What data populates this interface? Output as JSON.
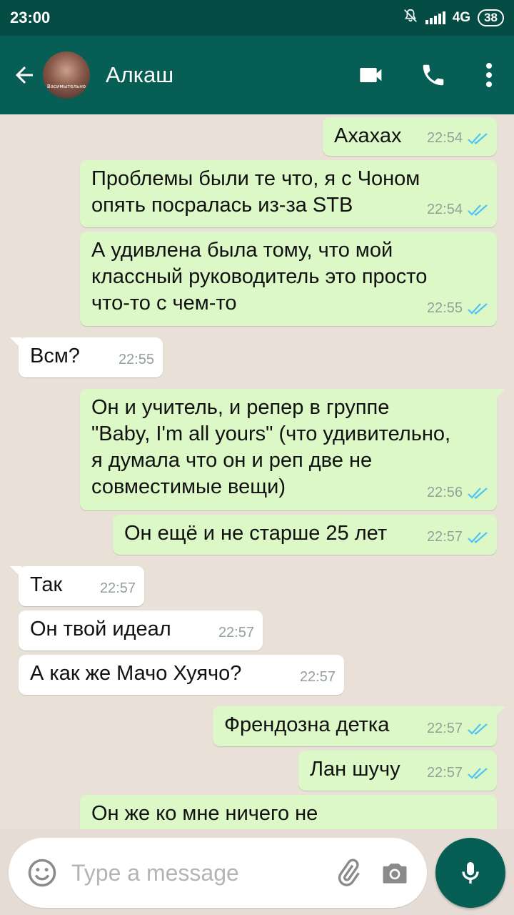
{
  "status": {
    "time": "23:00",
    "network": "4G",
    "battery": "38"
  },
  "header": {
    "contact_name": "Алкаш",
    "avatar_caption": "Васимытельно"
  },
  "messages": [
    {
      "dir": "out",
      "text": "Ахахах",
      "time": "22:54"
    },
    {
      "dir": "out",
      "text": "Проблемы были те что, я с Чоном опять посралась из-за STB",
      "time": "22:54"
    },
    {
      "dir": "out",
      "text": "А удивлена была тому, что мой классный руководитель это просто что-то с чем-то",
      "time": "22:55"
    },
    {
      "dir": "in",
      "text": "Всм?",
      "time": "22:55"
    },
    {
      "dir": "out",
      "text": "Он и учитель, и репер в группе \"Baby, I'm all yours\" (что удивительно, я думала что он и реп две не совместимые вещи)",
      "time": "22:56"
    },
    {
      "dir": "out",
      "text": "Он ещё и не старше 25 лет",
      "time": "22:57"
    },
    {
      "dir": "in",
      "text": "Так",
      "time": "22:57"
    },
    {
      "dir": "in",
      "text": "Он твой идеал",
      "time": "22:57"
    },
    {
      "dir": "in",
      "text": "А как же Мачо Хуячо?",
      "time": "22:57"
    },
    {
      "dir": "out",
      "text": "Френдозна детка",
      "time": "22:57"
    },
    {
      "dir": "out",
      "text": "Лан шучу",
      "time": "22:57"
    },
    {
      "dir": "out",
      "text": "Он же ко мне ничего не",
      "time": ""
    }
  ],
  "composer": {
    "placeholder": "Type a message"
  },
  "icons": {
    "back": "arrow-left-icon",
    "video": "videocam-icon",
    "call": "phone-icon",
    "menu": "more-vert-icon",
    "emoji": "smiley-icon",
    "attach": "paperclip-icon",
    "camera": "camera-icon",
    "mic": "microphone-icon",
    "ticks": "double-check-icon"
  },
  "colors": {
    "header": "#075e54",
    "statusbar": "#054d44",
    "outgoing_bubble": "#dcf8c6",
    "incoming_bubble": "#ffffff",
    "read_ticks": "#4fc3f7",
    "chat_background": "#e5ddd5"
  }
}
